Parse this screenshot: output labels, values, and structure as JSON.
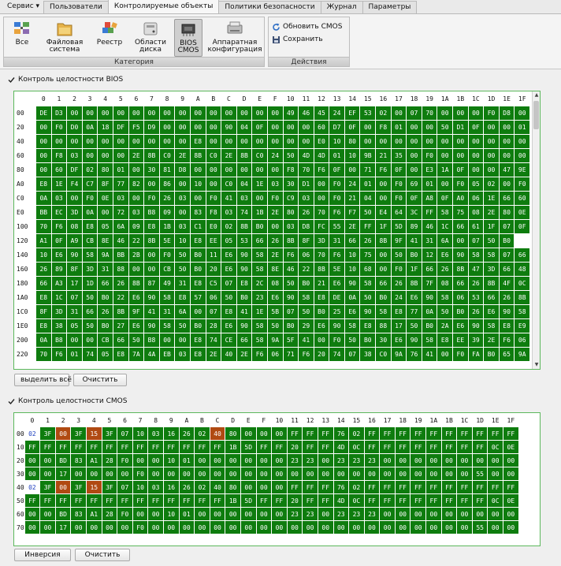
{
  "menu": {
    "service": "Сервис",
    "tabs": [
      "Пользователи",
      "Контролируемые объекты",
      "Политики безопасности",
      "Журнал",
      "Параметры"
    ],
    "active_tab": "Контролируемые объекты"
  },
  "ribbon": {
    "category_title": "Категория",
    "buttons": [
      {
        "line1": "Все",
        "line2": "",
        "icon": "all-objects-icon"
      },
      {
        "line1": "Файловая",
        "line2": "система",
        "icon": "file-system-icon"
      },
      {
        "line1": "Реестр",
        "line2": "",
        "icon": "registry-icon"
      },
      {
        "line1": "Области",
        "line2": "диска",
        "icon": "disk-areas-icon"
      },
      {
        "line1": "BIOS",
        "line2": "CMOS",
        "icon": "bios-chip-icon",
        "selected": true
      },
      {
        "line1": "Аппаратная",
        "line2": "конфигурация",
        "icon": "hardware-config-icon"
      }
    ],
    "actions_title": "Действия",
    "actions": [
      {
        "label": "Обновить CMOS",
        "icon": "refresh-cmos-icon"
      },
      {
        "label": "Сохранить",
        "icon": "save-icon"
      }
    ]
  },
  "bios": {
    "checkbox_label": "Контроль целостности BIOS",
    "checked": true,
    "columns": [
      "0",
      "1",
      "2",
      "3",
      "4",
      "5",
      "6",
      "7",
      "8",
      "9",
      "A",
      "B",
      "C",
      "D",
      "E",
      "F",
      "10",
      "11",
      "12",
      "13",
      "14",
      "15",
      "16",
      "17",
      "18",
      "19",
      "1A",
      "1B",
      "1C",
      "1D",
      "1E",
      "1F"
    ],
    "rows": [
      {
        "addr": "00",
        "cells": [
          "DE",
          "D3",
          "00",
          "00",
          "00",
          "00",
          "00",
          "00",
          "00",
          "00",
          "00",
          "00",
          "00",
          "00",
          "00",
          "00",
          "49",
          "46",
          "45",
          "24",
          "EF",
          "53",
          "02",
          "00",
          "07",
          "70",
          "00",
          "00",
          "00",
          "F0",
          "D8",
          "00"
        ]
      },
      {
        "addr": "20",
        "cells": [
          "00",
          "F0",
          "D0",
          "0A",
          "18",
          "DF",
          "F5",
          "D9",
          "00",
          "00",
          "00",
          "00",
          "90",
          "04",
          "0F",
          "00",
          "00",
          "00",
          "60",
          "D7",
          "0F",
          "00",
          "F8",
          "01",
          "00",
          "00",
          "50",
          "D1",
          "0F",
          "00",
          "00",
          "01"
        ]
      },
      {
        "addr": "40",
        "cells": [
          "00",
          "00",
          "00",
          "00",
          "00",
          "00",
          "00",
          "00",
          "00",
          "00",
          "E8",
          "00",
          "00",
          "00",
          "00",
          "00",
          "00",
          "00",
          "E0",
          "10",
          "80",
          "00",
          "00",
          "00",
          "00",
          "00",
          "00",
          "00",
          "00",
          "00",
          "00",
          "00"
        ]
      },
      {
        "addr": "60",
        "cells": [
          "00",
          "F8",
          "03",
          "00",
          "00",
          "00",
          "2E",
          "8B",
          "C0",
          "2E",
          "8B",
          "C0",
          "2E",
          "8B",
          "C0",
          "24",
          "50",
          "4D",
          "4D",
          "01",
          "10",
          "9B",
          "21",
          "35",
          "00",
          "F0",
          "00",
          "00",
          "00",
          "00",
          "00",
          "00"
        ]
      },
      {
        "addr": "80",
        "cells": [
          "00",
          "60",
          "DF",
          "02",
          "80",
          "01",
          "00",
          "30",
          "81",
          "D8",
          "00",
          "00",
          "00",
          "00",
          "00",
          "00",
          "F8",
          "70",
          "F6",
          "0F",
          "00",
          "71",
          "F6",
          "0F",
          "00",
          "E3",
          "1A",
          "0F",
          "00",
          "00",
          "47",
          "9E"
        ]
      },
      {
        "addr": "A0",
        "cells": [
          "E8",
          "1E",
          "F4",
          "C7",
          "8F",
          "77",
          "82",
          "00",
          "86",
          "00",
          "10",
          "00",
          "C0",
          "04",
          "1E",
          "03",
          "30",
          "D1",
          "00",
          "F0",
          "24",
          "01",
          "00",
          "F0",
          "69",
          "01",
          "00",
          "F0",
          "05",
          "02",
          "00",
          "F0"
        ]
      },
      {
        "addr": "C0",
        "cells": [
          "0A",
          "03",
          "00",
          "F0",
          "0E",
          "03",
          "00",
          "F0",
          "26",
          "03",
          "00",
          "F0",
          "41",
          "03",
          "00",
          "F0",
          "C9",
          "03",
          "00",
          "F0",
          "21",
          "04",
          "00",
          "F0",
          "0F",
          "A8",
          "0F",
          "A0",
          "06",
          "1E",
          "66",
          "60"
        ]
      },
      {
        "addr": "E0",
        "cells": [
          "BB",
          "EC",
          "3D",
          "0A",
          "00",
          "72",
          "03",
          "B8",
          "09",
          "00",
          "83",
          "F8",
          "03",
          "74",
          "1B",
          "2E",
          "80",
          "26",
          "70",
          "F6",
          "F7",
          "50",
          "E4",
          "64",
          "3C",
          "FF",
          "58",
          "75",
          "08",
          "2E",
          "80",
          "0E"
        ]
      },
      {
        "addr": "100",
        "cells": [
          "70",
          "F6",
          "08",
          "E8",
          "05",
          "6A",
          "09",
          "E8",
          "1B",
          "03",
          "C1",
          "E0",
          "02",
          "8B",
          "B0",
          "00",
          "03",
          "D8",
          "FC",
          "55",
          "2E",
          "FF",
          "1F",
          "5D",
          "89",
          "46",
          "1C",
          "66",
          "61",
          "1F",
          "07",
          "0F"
        ]
      },
      {
        "addr": "120",
        "cells": [
          "A1",
          "0F",
          "A9",
          "CB",
          "8E",
          "46",
          "22",
          "8B",
          "5E",
          "10",
          "E8",
          "EE",
          "05",
          "53",
          "66",
          "26",
          "8B",
          "8F",
          "3D",
          "31",
          "66",
          "26",
          "8B",
          "9F",
          "41",
          "31",
          "6A",
          "00",
          "07",
          "50",
          "B0"
        ]
      },
      {
        "addr": "140",
        "cells": [
          "10",
          "E6",
          "90",
          "58",
          "9A",
          "BB",
          "2B",
          "00",
          "F0",
          "50",
          "B0",
          "11",
          "E6",
          "90",
          "58",
          "2E",
          "F6",
          "06",
          "70",
          "F6",
          "10",
          "75",
          "00",
          "50",
          "B0",
          "12",
          "E6",
          "90",
          "58",
          "58",
          "07",
          "66"
        ]
      },
      {
        "addr": "160",
        "cells": [
          "26",
          "89",
          "8F",
          "3D",
          "31",
          "88",
          "00",
          "00",
          "CB",
          "50",
          "B0",
          "20",
          "E6",
          "90",
          "58",
          "8E",
          "46",
          "22",
          "8B",
          "5E",
          "10",
          "68",
          "00",
          "F0",
          "1F",
          "66",
          "26",
          "8B",
          "47",
          "3D",
          "66",
          "48"
        ]
      },
      {
        "addr": "180",
        "cells": [
          "66",
          "A3",
          "17",
          "1D",
          "66",
          "26",
          "8B",
          "87",
          "49",
          "31",
          "E8",
          "C5",
          "07",
          "E8",
          "2C",
          "08",
          "50",
          "B0",
          "21",
          "E6",
          "90",
          "58",
          "66",
          "26",
          "8B",
          "7F",
          "08",
          "66",
          "26",
          "8B",
          "4F",
          "0C"
        ]
      },
      {
        "addr": "1A0",
        "cells": [
          "E8",
          "1C",
          "07",
          "50",
          "B0",
          "22",
          "E6",
          "90",
          "58",
          "E8",
          "57",
          "06",
          "50",
          "B0",
          "23",
          "E6",
          "90",
          "58",
          "E8",
          "DE",
          "0A",
          "50",
          "B0",
          "24",
          "E6",
          "90",
          "58",
          "06",
          "53",
          "66",
          "26",
          "8B"
        ]
      },
      {
        "addr": "1C0",
        "cells": [
          "8F",
          "3D",
          "31",
          "66",
          "26",
          "8B",
          "9F",
          "41",
          "31",
          "6A",
          "00",
          "07",
          "E8",
          "41",
          "1E",
          "5B",
          "07",
          "50",
          "B0",
          "25",
          "E6",
          "90",
          "58",
          "E8",
          "77",
          "0A",
          "50",
          "B0",
          "26",
          "E6",
          "90",
          "58"
        ]
      },
      {
        "addr": "1E0",
        "cells": [
          "E8",
          "38",
          "05",
          "50",
          "B0",
          "27",
          "E6",
          "90",
          "58",
          "50",
          "B0",
          "28",
          "E6",
          "90",
          "58",
          "50",
          "B0",
          "29",
          "E6",
          "90",
          "58",
          "E8",
          "88",
          "17",
          "50",
          "B0",
          "2A",
          "E6",
          "90",
          "58",
          "E8",
          "E9"
        ]
      },
      {
        "addr": "200",
        "cells": [
          "0A",
          "B8",
          "00",
          "00",
          "CB",
          "66",
          "50",
          "B8",
          "00",
          "00",
          "E8",
          "74",
          "CE",
          "66",
          "58",
          "9A",
          "5F",
          "41",
          "00",
          "F0",
          "50",
          "B0",
          "30",
          "E6",
          "90",
          "58",
          "E8",
          "EE",
          "39",
          "2E",
          "F6",
          "06"
        ]
      },
      {
        "addr": "220",
        "cells": [
          "70",
          "F6",
          "01",
          "74",
          "05",
          "E8",
          "7A",
          "4A",
          "EB",
          "03",
          "E8",
          "2E",
          "40",
          "2E",
          "F6",
          "06",
          "71",
          "F6",
          "20",
          "74",
          "07",
          "38",
          "C0",
          "9A",
          "76",
          "41",
          "00",
          "F0",
          "FA",
          "B0",
          "65",
          "9A"
        ]
      }
    ],
    "select_all": "выделить всё",
    "clear": "Очистить"
  },
  "cmos": {
    "checkbox_label": "Контроль целостности CMOS",
    "checked": true,
    "columns": [
      "0",
      "1",
      "2",
      "3",
      "4",
      "5",
      "6",
      "7",
      "8",
      "9",
      "A",
      "B",
      "C",
      "D",
      "E",
      "F",
      "10",
      "11",
      "12",
      "13",
      "14",
      "15",
      "16",
      "17",
      "18",
      "19",
      "1A",
      "1B",
      "1C",
      "1D",
      "1E",
      "1F"
    ],
    "rows": [
      {
        "addr": "00",
        "cells": [
          "02",
          "3F",
          "00",
          "3F",
          "15",
          "3F",
          "07",
          "10",
          "03",
          "16",
          "26",
          "02",
          "40",
          "80",
          "00",
          "00",
          "00",
          "FF",
          "FF",
          "FF",
          "76",
          "02",
          "FF",
          "FF",
          "FF",
          "FF",
          "FF",
          "FF",
          "FF",
          "FF",
          "FF",
          "FF"
        ],
        "flags": {
          "0": "b",
          "2": "r",
          "4": "r",
          "12": "r"
        }
      },
      {
        "addr": "10",
        "cells": [
          "FF",
          "FF",
          "FF",
          "FF",
          "FF",
          "FF",
          "FF",
          "FF",
          "FF",
          "FF",
          "FF",
          "FF",
          "FF",
          "1B",
          "5D",
          "FF",
          "FF",
          "20",
          "FF",
          "FF",
          "4D",
          "0C",
          "FF",
          "FF",
          "FF",
          "FF",
          "FF",
          "FF",
          "FF",
          "FF",
          "0C",
          "0E"
        ]
      },
      {
        "addr": "20",
        "cells": [
          "00",
          "00",
          "BD",
          "83",
          "A1",
          "28",
          "F0",
          "00",
          "00",
          "10",
          "01",
          "00",
          "00",
          "00",
          "00",
          "00",
          "00",
          "23",
          "23",
          "00",
          "23",
          "23",
          "23",
          "00",
          "00",
          "00",
          "00",
          "00",
          "00",
          "00",
          "00",
          "00"
        ]
      },
      {
        "addr": "30",
        "cells": [
          "00",
          "00",
          "17",
          "00",
          "00",
          "00",
          "00",
          "F0",
          "00",
          "00",
          "00",
          "00",
          "00",
          "00",
          "00",
          "00",
          "00",
          "00",
          "00",
          "00",
          "00",
          "00",
          "00",
          "00",
          "00",
          "00",
          "00",
          "00",
          "00",
          "55",
          "00",
          "00"
        ]
      },
      {
        "addr": "40",
        "cells": [
          "02",
          "3F",
          "00",
          "3F",
          "15",
          "3F",
          "07",
          "10",
          "03",
          "16",
          "26",
          "02",
          "40",
          "80",
          "00",
          "00",
          "00",
          "FF",
          "FF",
          "FF",
          "76",
          "02",
          "FF",
          "FF",
          "FF",
          "FF",
          "FF",
          "FF",
          "FF",
          "FF",
          "FF",
          "FF"
        ],
        "flags": {
          "0": "b",
          "2": "r",
          "4": "r"
        }
      },
      {
        "addr": "50",
        "cells": [
          "FF",
          "FF",
          "FF",
          "FF",
          "FF",
          "FF",
          "FF",
          "FF",
          "FF",
          "FF",
          "FF",
          "FF",
          "FF",
          "1B",
          "5D",
          "FF",
          "FF",
          "20",
          "FF",
          "FF",
          "4D",
          "0C",
          "FF",
          "FF",
          "FF",
          "FF",
          "FF",
          "FF",
          "FF",
          "FF",
          "0C",
          "0E"
        ]
      },
      {
        "addr": "60",
        "cells": [
          "00",
          "00",
          "BD",
          "83",
          "A1",
          "28",
          "F0",
          "00",
          "00",
          "10",
          "01",
          "00",
          "00",
          "00",
          "00",
          "00",
          "00",
          "23",
          "23",
          "00",
          "23",
          "23",
          "23",
          "00",
          "00",
          "00",
          "00",
          "00",
          "00",
          "00",
          "00",
          "00"
        ]
      },
      {
        "addr": "70",
        "cells": [
          "00",
          "00",
          "17",
          "00",
          "00",
          "00",
          "00",
          "F0",
          "00",
          "00",
          "00",
          "00",
          "00",
          "00",
          "00",
          "00",
          "00",
          "00",
          "00",
          "00",
          "00",
          "00",
          "00",
          "00",
          "00",
          "00",
          "00",
          "00",
          "00",
          "55",
          "00",
          "00"
        ]
      }
    ],
    "invert": "Инверсия",
    "clear": "Очистить"
  },
  "colors": {
    "grid_green": "#0e7c0e",
    "changed_cell": "#b04a12",
    "panel_border": "#5cb85c"
  }
}
